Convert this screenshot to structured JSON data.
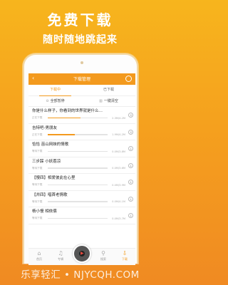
{
  "promo": {
    "title": "免费下载",
    "subtitle": "随时随地跳起来"
  },
  "app": {
    "header_title": "下载管理",
    "back_icon": "‹",
    "tabs": [
      "下载中",
      "已下载"
    ],
    "actions": {
      "pause_all": "全部暂停",
      "clear_all": "一键清空"
    },
    "items": [
      {
        "title": "你是什么样子，你看到的世界就是什么…",
        "status": "正在下载",
        "size": "2.3M/4.2M",
        "progress": 0.55
      },
      {
        "title": "吉特吧-男朋友",
        "status": "正在下载",
        "size": "1.9M/4.2M",
        "progress": 0.45
      },
      {
        "title": "恰恰 苗山网妹的情歌",
        "status": "等待下载",
        "size": "0.0M/3.8M",
        "progress": 0
      },
      {
        "title": "三步踩 小妖荔凉",
        "status": "等待下载",
        "size": "0.0M/3.6M",
        "progress": 0
      },
      {
        "title": "【慢四】相爱彼此在心里",
        "status": "等待下载",
        "size": "0.0M/3.9M",
        "progress": 0
      },
      {
        "title": "【并四】唱首老情歌",
        "status": "等待下载",
        "size": "0.0M/4.1M",
        "progress": 0
      },
      {
        "title": "杨小慢 相依偎",
        "status": "等待下载",
        "size": "0.0M/3.7M",
        "progress": 0
      }
    ],
    "bottom_nav": [
      {
        "label": "首页",
        "icon": "⌂"
      },
      {
        "label": "专辑",
        "icon": "♫"
      },
      {
        "label": "",
        "icon": ""
      },
      {
        "label": "搜索",
        "icon": "⚲"
      },
      {
        "label": "下载",
        "icon": "⇩"
      }
    ]
  },
  "watermark": "乐享轻汇 • NJYCQH.COM",
  "colors": {
    "accent": "#f39a1e",
    "background": "#f5a01e"
  }
}
